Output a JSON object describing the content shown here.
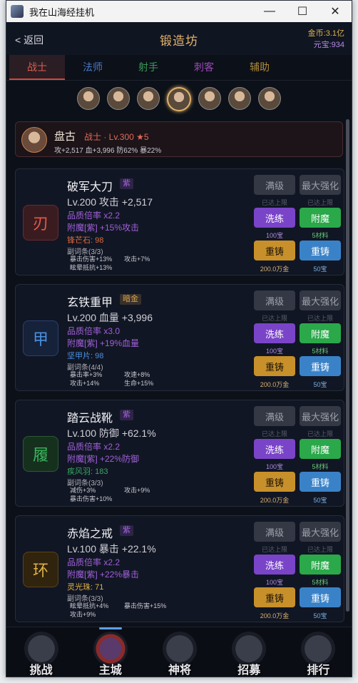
{
  "window": {
    "title": "我在山海经挂机",
    "min_icon": "minimize-icon",
    "max_icon": "maximize-icon",
    "close_icon": "close-icon"
  },
  "header": {
    "back_label": "< 返回",
    "title": "锻造坊",
    "gold": "金币:3.1亿",
    "yuanbao": "元宝:934"
  },
  "tabs": [
    {
      "label": "战士",
      "color": "#e05a4a",
      "active": true
    },
    {
      "label": "法师",
      "color": "#4a7ac8"
    },
    {
      "label": "射手",
      "color": "#3a9a5a"
    },
    {
      "label": "刺客",
      "color": "#9a4ab8"
    },
    {
      "label": "辅助",
      "color": "#b08a3a"
    }
  ],
  "avatars": [
    "hero-avatar-1",
    "hero-avatar-2",
    "hero-avatar-3",
    "hero-avatar-4",
    "hero-avatar-5",
    "hero-avatar-6",
    "hero-avatar-7"
  ],
  "hero": {
    "name": "盘古",
    "sub": "战士 · Lv.300 ★5",
    "stats": "攻+2,517  血+3,996  防62%  暴22%"
  },
  "buttons": {
    "max_level": "满级",
    "max_enhance": "最大强化",
    "limit_note": "已达上限",
    "reroll": "洗练",
    "enchant": "附魔",
    "recast_a": "重铸",
    "recast_b": "重铸"
  },
  "items": [
    {
      "glyph": "刃",
      "name": "破军大刀",
      "badge": "紫",
      "badge_color": "#a060d8",
      "level": "Lv.200  攻击 +2,517",
      "quality": "品质倍率 x2.2",
      "enchant": "附魔[紫] +15%攻击",
      "material": "锋芒石: 98",
      "material_color": "#e06a3a",
      "sub_title": "副词条(3/3)",
      "subs": [
        "暴击伤害+13%",
        "攻击+7%",
        "眩晕抵抗+13%",
        ""
      ],
      "reroll_cost": "100宝",
      "enchant_cost": "5材料",
      "recast_gold": "200.0万金",
      "recast_yb": "50宝",
      "glyph_color": "#e05a4a",
      "glyph_bg": "#3a1c20",
      "glyph_border": "#6a2a30"
    },
    {
      "glyph": "甲",
      "name": "玄铁重甲",
      "badge": "暗金",
      "badge_color": "#d8a04a",
      "level": "Lv.200  血量 +3,996",
      "quality": "品质倍率 x3.0",
      "enchant": "附魔[紫] +19%血量",
      "material": "坚甲片: 98",
      "material_color": "#4a90e0",
      "sub_title": "副词条(4/4)",
      "subs": [
        "暴击率+3%",
        "攻速+8%",
        "攻击+14%",
        "生命+15%"
      ],
      "reroll_cost": "100宝",
      "enchant_cost": "5材料",
      "recast_gold": "200.0万金",
      "recast_yb": "50宝",
      "glyph_color": "#4a90e0",
      "glyph_bg": "#16223a",
      "glyph_border": "#2a4070"
    },
    {
      "glyph": "履",
      "name": "踏云战靴",
      "badge": "紫",
      "badge_color": "#a060d8",
      "level": "Lv.100  防御 +62.1%",
      "quality": "品质倍率 x2.2",
      "enchant": "附魔[紫] +22%防御",
      "material": "疾风羽: 183",
      "material_color": "#3aa860",
      "sub_title": "副词条(3/3)",
      "subs": [
        "减伤+3%",
        "攻击+9%",
        "暴击伤害+10%",
        ""
      ],
      "reroll_cost": "100宝",
      "enchant_cost": "5材料",
      "recast_gold": "200.0万金",
      "recast_yb": "50宝",
      "glyph_color": "#3ab860",
      "glyph_bg": "#16301e",
      "glyph_border": "#2a5a36"
    },
    {
      "glyph": "环",
      "name": "赤焰之戒",
      "badge": "紫",
      "badge_color": "#a060d8",
      "level": "Lv.100  暴击 +22.1%",
      "quality": "品质倍率 x2.2",
      "enchant": "附魔[紫] +22%暴击",
      "material": "灵光珠: 71",
      "material_color": "#e0b24a",
      "sub_title": "副词条(3/3)",
      "subs": [
        "眩晕抵抗+4%",
        "暴击伤害+15%",
        "攻击+9%",
        ""
      ],
      "reroll_cost": "100宝",
      "enchant_cost": "5材料",
      "recast_gold": "200.0万金",
      "recast_yb": "50宝",
      "glyph_color": "#e0b24a",
      "glyph_bg": "#30240e",
      "glyph_border": "#5a4418"
    }
  ],
  "nav": [
    {
      "label": "挑战",
      "icon": "challenge-icon"
    },
    {
      "label": "主城",
      "icon": "main-city-icon",
      "active": true
    },
    {
      "label": "神将",
      "icon": "heroes-icon"
    },
    {
      "label": "招募",
      "icon": "recruit-icon"
    },
    {
      "label": "排行",
      "icon": "ranking-icon"
    }
  ]
}
